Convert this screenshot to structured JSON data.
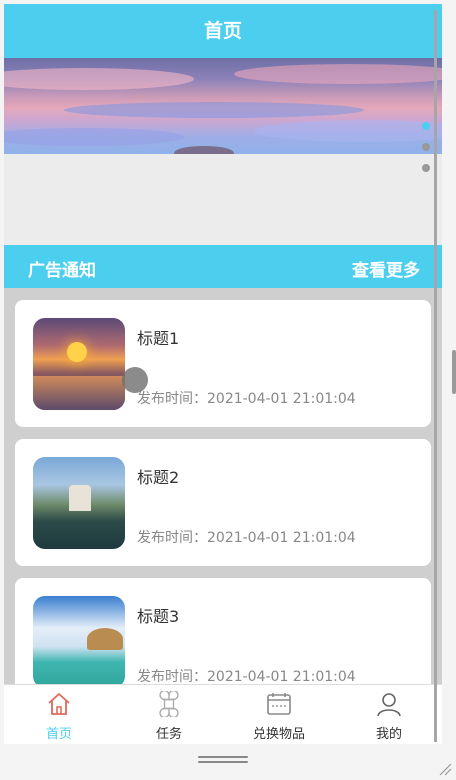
{
  "header": {
    "title": "首页"
  },
  "banner": {
    "dot_count": 3,
    "active_dot": 0
  },
  "section": {
    "title": "广告通知",
    "more_label": "查看更多"
  },
  "list": {
    "items": [
      {
        "title": "标题1",
        "time": "发布时间：2021-04-01 21:01:04"
      },
      {
        "title": "标题2",
        "time": "发布时间：2021-04-01 21:01:04"
      },
      {
        "title": "标题3",
        "time": "发布时间：2021-04-01 21:01:04"
      }
    ]
  },
  "tabbar": {
    "tabs": [
      {
        "label": "首页",
        "icon": "home-icon",
        "active": true
      },
      {
        "label": "任务",
        "icon": "task-icon",
        "active": false
      },
      {
        "label": "兑换物品",
        "icon": "exchange-icon",
        "active": false
      },
      {
        "label": "我的",
        "icon": "user-icon",
        "active": false
      }
    ]
  },
  "colors": {
    "accent": "#4ccfef",
    "text_dark": "#333333",
    "text_muted": "#888888",
    "active_icon": "#e06a5a"
  }
}
